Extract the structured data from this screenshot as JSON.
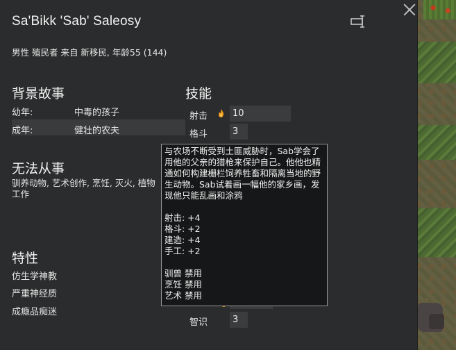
{
  "pawn": {
    "name": "Sa'Bikk 'Sab' Saleosy",
    "description": "男性 殖民者 来自 新移民, 年龄55 (144)"
  },
  "backstory": {
    "heading": "背景故事",
    "childhood_label": "幼年:",
    "childhood_value": "中毒的孩子",
    "adulthood_label": "成年:",
    "adulthood_value": "健壮的农夫"
  },
  "incapable": {
    "heading": "无法从事",
    "text": "驯养动物, 艺术创作, 烹饪, 灭火, 植物工作"
  },
  "traits": {
    "heading": "特性",
    "items": [
      "仿生学神教",
      "严重神经质",
      "成瘾品痴迷"
    ]
  },
  "skills": {
    "heading": "技能",
    "items": [
      {
        "label": "射击",
        "value": "10",
        "passion": true
      },
      {
        "label": "格斗",
        "value": "3",
        "passion": false
      },
      {
        "label": "智识",
        "value": "3",
        "passion": false
      }
    ]
  },
  "tooltip": {
    "story": "与农场不断受到土匪威胁时，Sab学会了用他的父亲的猎枪来保护自己。他他也精通如何构建栅栏饲养牲畜和隔离当地的野生动物。Sab试着画一幅他的家乡画，发现他只能乱画和涂鸦",
    "bonuses": [
      "射击:   +4",
      "格斗:   +2",
      "建造:   +4",
      "手工:   +2"
    ],
    "disabled": [
      "驯兽 禁用",
      "烹饪 禁用",
      "艺术 禁用"
    ]
  },
  "colors": {
    "panel_bg": "#2b2c2d",
    "tooltip_bg": "#161718",
    "tooltip_border": "#9b9b9b",
    "passion_flame": "#f0a020"
  },
  "icons": [
    "close-icon",
    "rename-icon",
    "flame-icon"
  ]
}
